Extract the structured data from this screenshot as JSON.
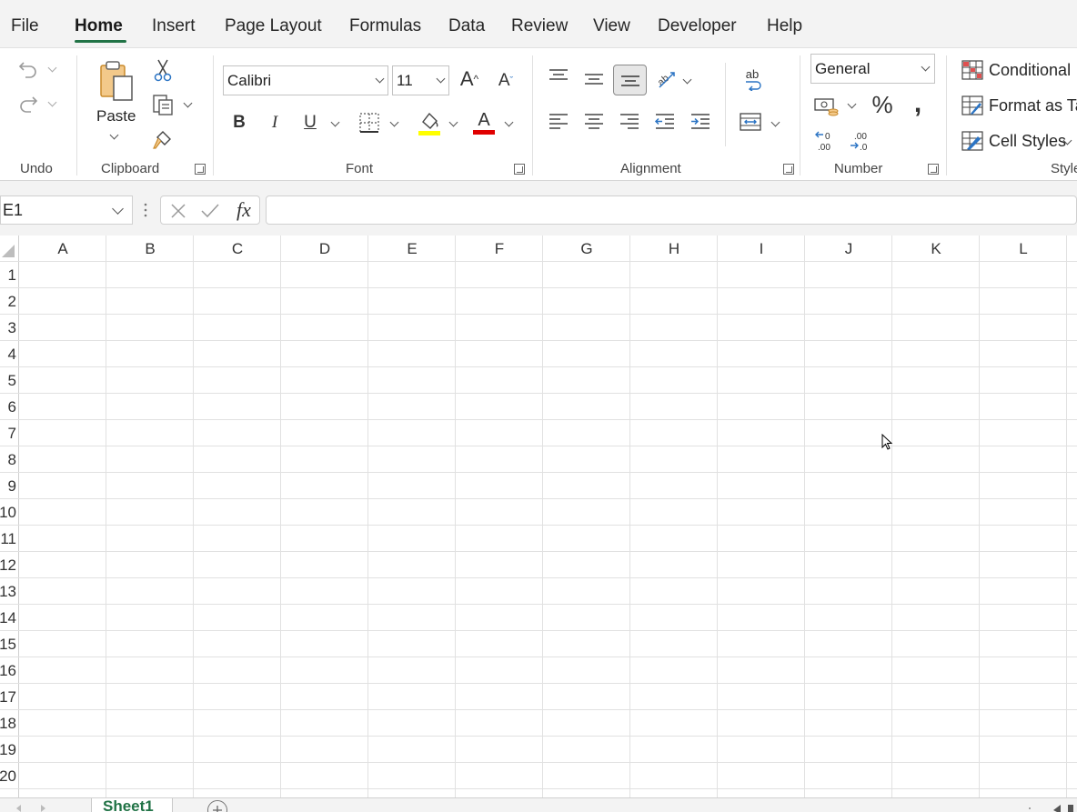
{
  "menu": {
    "items": [
      "File",
      "Home",
      "Insert",
      "Page Layout",
      "Formulas",
      "Data",
      "Review",
      "View",
      "Developer",
      "Help"
    ],
    "active": "Home"
  },
  "ribbon": {
    "groups": {
      "undo": "Undo",
      "clipboard": "Clipboard",
      "font": "Font",
      "alignment": "Alignment",
      "number": "Number",
      "styles": "Style"
    },
    "paste_label": "Paste",
    "font_name": "Calibri",
    "font_size": "11",
    "bold": "B",
    "italic": "I",
    "underline": "U",
    "grow_font": "A",
    "shrink_font": "A",
    "font_color_glyph": "A",
    "number_format": "General",
    "percent": "%",
    "comma": ",",
    "wrap_text_glyph": "ab",
    "conditional_label": "Conditional",
    "format_as_table_label": "Format as Ta",
    "cell_styles_label": "Cell Styles",
    "highlight_color": "#ffff00",
    "font_color": "#e00000"
  },
  "formula_bar": {
    "name_box": "E1",
    "fx": "fx",
    "formula": ""
  },
  "grid": {
    "columns": [
      "A",
      "B",
      "C",
      "D",
      "E",
      "F",
      "G",
      "H",
      "I",
      "J",
      "K",
      "L"
    ],
    "rows": [
      "1",
      "2",
      "3",
      "4",
      "5",
      "6",
      "7",
      "8",
      "9",
      "10",
      "11",
      "12",
      "13",
      "14",
      "15",
      "16",
      "17",
      "18",
      "19",
      "20"
    ]
  },
  "sheets": {
    "tabs": [
      "Sheet1"
    ],
    "active": "Sheet1"
  },
  "colors": {
    "accent": "#217346",
    "gridline": "#e1e1e1"
  }
}
